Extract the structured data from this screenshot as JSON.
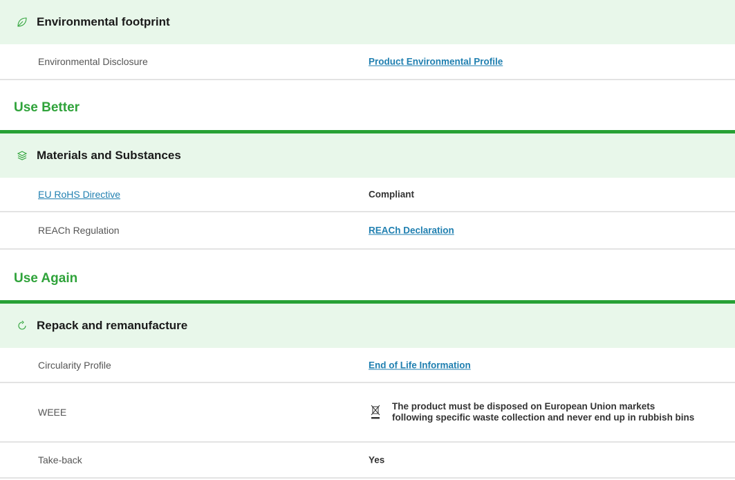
{
  "sections": {
    "environmental_footprint": {
      "title": "Environmental footprint",
      "icon": "leaf-icon",
      "rows": {
        "environmental_disclosure": {
          "label": "Environmental Disclosure",
          "value": "Product Environmental Profile"
        }
      }
    },
    "use_better": {
      "group_title": "Use Better",
      "materials_and_substances": {
        "title": "Materials and Substances",
        "icon": "layers-icon",
        "rows": {
          "eu_rohs": {
            "label": "EU RoHS Directive",
            "value": "Compliant"
          },
          "reach": {
            "label": "REACh Regulation",
            "value": "REACh Declaration"
          }
        }
      }
    },
    "use_again": {
      "group_title": "Use Again",
      "repack_and_remanufacture": {
        "title": "Repack and remanufacture",
        "icon": "refresh-icon",
        "rows": {
          "circularity": {
            "label": "Circularity Profile",
            "value": "End of Life Information"
          },
          "weee": {
            "label": "WEEE",
            "value": "The product must be disposed on European Union markets following specific waste collection and never end up in rubbish bins",
            "icon": "crossed-out-bin-icon"
          },
          "take_back": {
            "label": "Take-back",
            "value": "Yes"
          }
        }
      }
    }
  },
  "colors": {
    "section_bg": "#e8f7ea",
    "group_title": "#2fa33a",
    "group_bar": "#27a135",
    "link": "#1f7fb0"
  }
}
